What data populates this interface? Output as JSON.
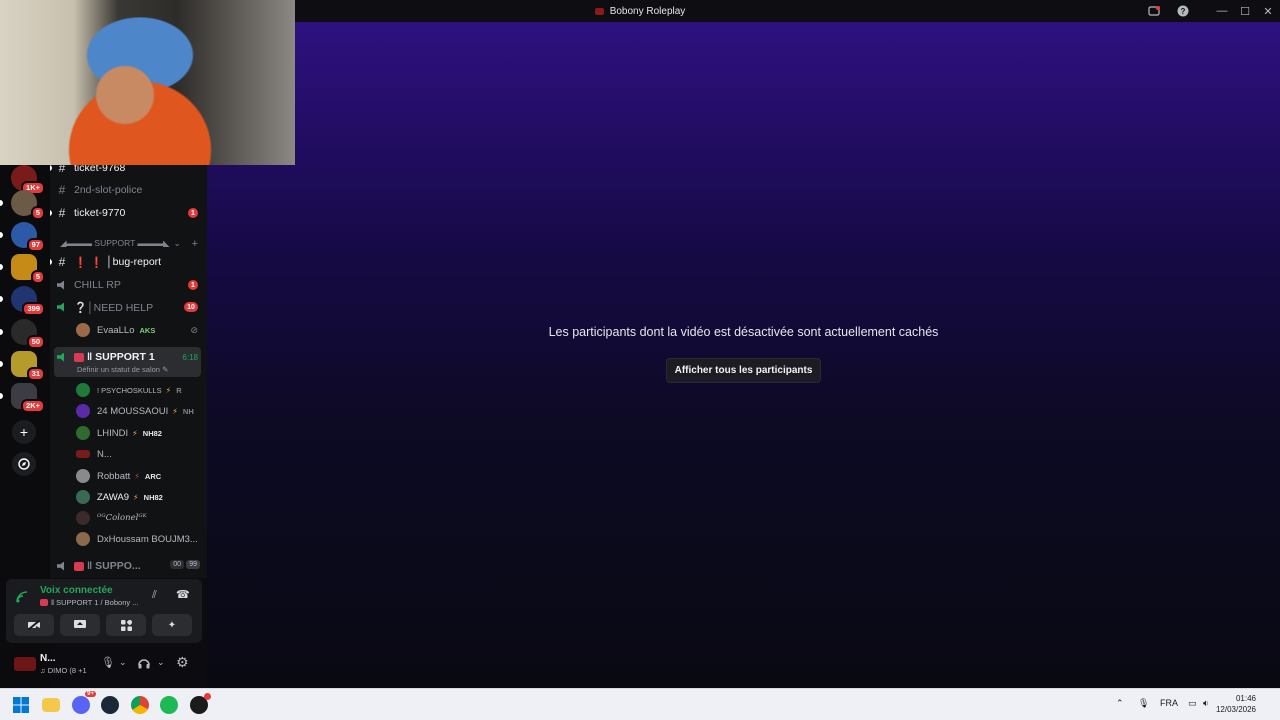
{
  "window": {
    "title": "Bobony Roleplay",
    "controls": {
      "minimize": "—",
      "maximize": "☐",
      "close": "✕"
    }
  },
  "servers": [
    {
      "badge": "1K+"
    },
    {
      "badge": "5"
    },
    {
      "badge": "97"
    },
    {
      "badge": "5"
    },
    {
      "badge": "399"
    },
    {
      "badge": "50"
    },
    {
      "badge": "31"
    },
    {
      "badge": "2K+"
    }
  ],
  "channels": {
    "top": [
      {
        "name": "ticket-9768",
        "unread": true
      },
      {
        "name": "2nd-slot-police",
        "unread": false
      },
      {
        "name": "ticket-9770",
        "unread": true,
        "badge": "1"
      }
    ],
    "category": "◢▬▬▬ SUPPORT ▬▬▬◣",
    "bug_report": {
      "prefix": "❗ ❗",
      "name": "│bug-report"
    },
    "chill_rp": {
      "name": "CHILL RP",
      "badge": "1"
    },
    "need_help": {
      "name": "❔│NEED HELP",
      "badge": "10"
    },
    "need_help_users": [
      {
        "name": "EvaaLLo",
        "tag": "AKS"
      }
    ],
    "support1": {
      "name": "‖ SUPPORT 1",
      "timer": "6:18",
      "status": "Définir un statut de salon"
    },
    "support1_users": [
      {
        "name": "! PSYCHOSKULLS",
        "tag": "R"
      },
      {
        "name": "24 MOUSSAOUI",
        "tag": "NH"
      },
      {
        "name": "LHINDI",
        "tag": "NH82"
      },
      {
        "name": "N...",
        "tag": ""
      },
      {
        "name": "Robbatt",
        "tag": "ARC"
      },
      {
        "name": "ZAWA9",
        "tag": "NH82"
      },
      {
        "name": "ᴼᴳColonelᴳᴷ",
        "tag": ""
      },
      {
        "name": "DxHoussam BOUJM3...",
        "tag": ""
      }
    ],
    "support_next": {
      "name": "‖ SUPPO...",
      "count_a": "00",
      "count_b": "99"
    }
  },
  "voice_panel": {
    "status": "Voix connectée",
    "location": "‖ SUPPORT 1 / Bobony ..."
  },
  "user_panel": {
    "name": "N...",
    "activity": "♫ DIMO (8 +1"
  },
  "main": {
    "hidden_message": "Les participants dont la vidéo est désactivée sont actuellement cachés",
    "show_all_button": "Afficher tous les participants"
  },
  "taskbar": {
    "lang": "FRA",
    "time": "01:46",
    "date": "12/03/2026",
    "discord_badge": "9+"
  }
}
